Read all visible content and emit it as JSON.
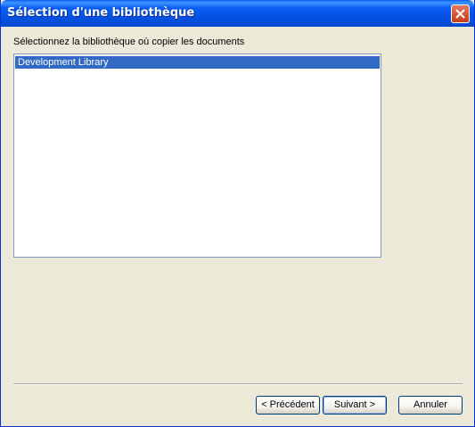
{
  "window": {
    "title": "Sélection d'une bibliothèque",
    "close_icon": "close-icon"
  },
  "content": {
    "instruction": "Sélectionnez la bibliothèque où copier les documents",
    "libraries": [
      {
        "label": "Development Library",
        "selected": true
      }
    ]
  },
  "buttons": {
    "previous": "< Précédent",
    "next": "Suivant >",
    "cancel": "Annuler"
  },
  "colors": {
    "titlebar": "#0a5df3",
    "selection": "#316ac5",
    "dialog_bg": "#ece9d8",
    "close_button": "#d4502e"
  }
}
